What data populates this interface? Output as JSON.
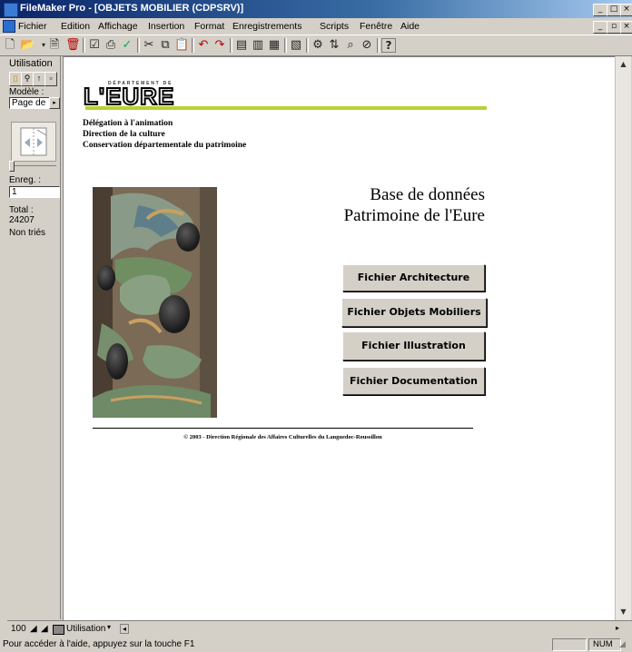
{
  "window": {
    "title": "FileMaker Pro - [OBJETS MOBILIER (CDPSRV)]",
    "controls": [
      "_",
      "□",
      "×"
    ],
    "doc_controls": [
      "_",
      "▫",
      "×"
    ]
  },
  "menu": [
    "Fichier",
    "Edition",
    "Affichage",
    "Insertion",
    "Format",
    "Enregistrements",
    "Scripts",
    "Fenêtre",
    "Aide"
  ],
  "toolbar": {
    "icons": [
      "new-document-icon",
      "open-icon",
      "dropdown-arrow-icon",
      "new-record-icon",
      "delete-record-icon",
      "checkbox-icon",
      "print-icon",
      "spellcheck-icon",
      "cut-icon",
      "copy-icon",
      "paste-icon",
      "undo-icon",
      "redo-icon",
      "browse-mode-icon",
      "find-mode-icon",
      "layout-mode-icon",
      "chart-icon",
      "tool-icon",
      "sort-icon",
      "find-icon",
      "omit-icon",
      "help-icon"
    ]
  },
  "left_panel": {
    "mode_label": "Utilisation",
    "layout_label": "Modèle :",
    "layout_value": "Page de",
    "record_label": "Enreg. :",
    "record_value": "1",
    "total_label": "Total :",
    "total_value": "24207",
    "sort_status": "Non triés"
  },
  "content": {
    "logo_small": "DÉPARTEMENT DE",
    "logo_word": "L'EURE",
    "delegation_lines": [
      "Délégation à l'animation",
      "Direction de la culture",
      "Conservation départementale du patrimoine"
    ],
    "title_line1": "Base de données",
    "title_line2": "Patrimoine de l'Eure",
    "buttons": [
      "Fichier Architecture",
      "Fichier Objets Mobiliers",
      "Fichier Illustration",
      "Fichier Documentation"
    ],
    "copyright": "© 2003 - Direction Régionale des Affaires Culturelles du Languedoc-Roussillon"
  },
  "bottom": {
    "zoom": "100",
    "mode_select": "Utilisation"
  },
  "status": {
    "help_text": "Pour accéder à l'aide, appuyez sur la touche F1",
    "num": "NUM"
  },
  "colors": {
    "titlebar_start": "#0a246a",
    "titlebar_end": "#a6caf0",
    "logo_bar": "#b5d334",
    "chrome": "#d4d0c8"
  }
}
